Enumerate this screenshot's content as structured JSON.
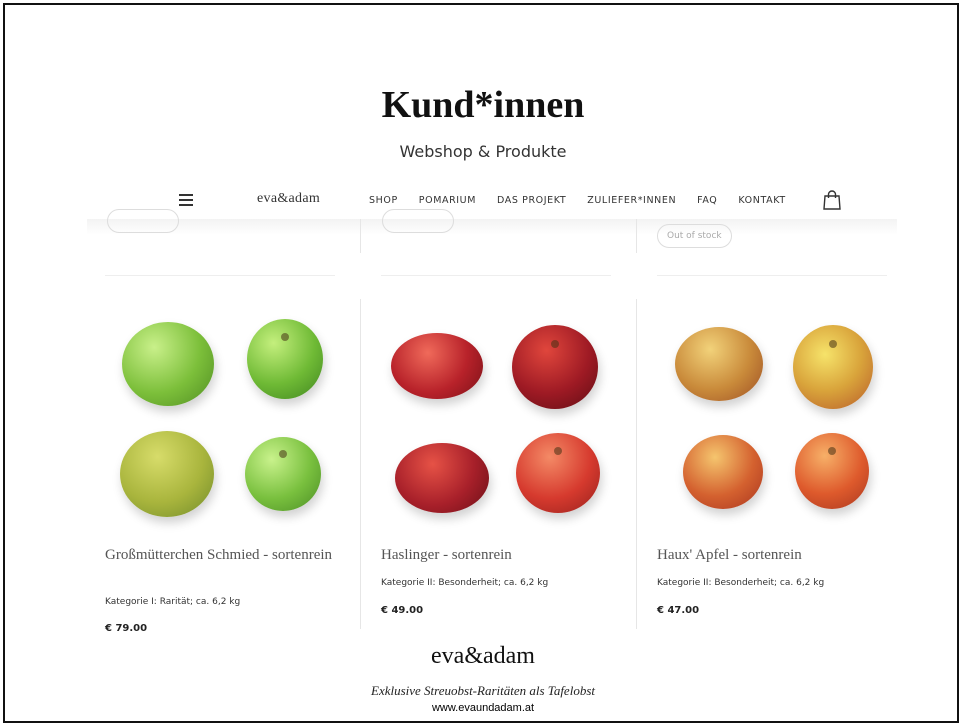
{
  "slide": {
    "title": "Kund*innen",
    "subtitle": "Webshop & Produkte"
  },
  "navbar": {
    "logo": "eva&adam",
    "links": [
      "SHOP",
      "POMARIUM",
      "DAS PROJEKT",
      "ZULIEFER*INNEN",
      "FAQ",
      "KONTAKT"
    ]
  },
  "previous_row": {
    "stock_badge": "Out of stock"
  },
  "products": [
    {
      "name": "Großmütterchen Schmied - sortenrein",
      "meta": "Kategorie I: Rarität; ca. 6,2 kg",
      "price": "€ 79.00",
      "apple_colors": [
        "#7cbf3a",
        "#6fba35",
        "#a9b53d",
        "#79c03e"
      ]
    },
    {
      "name": "Haslinger - sortenrein",
      "meta": "Kategorie II: Besonderheit; ca. 6,2 kg",
      "price": "€ 49.00",
      "apple_colors": [
        "#b8222a",
        "#9e1a24",
        "#a8202a",
        "#d63a2e"
      ]
    },
    {
      "name": "Haux' Apfel - sortenrein",
      "meta": "Kategorie II: Besonderheit; ca. 6,2 kg",
      "price": "€ 47.00",
      "apple_colors": [
        "#c98a3a",
        "#d9a43b",
        "#d4612f",
        "#de5a2c"
      ]
    }
  ],
  "footer": {
    "logo": "eva&adam",
    "tagline": "Exklusive Streuobst-Raritäten als Tafelobst",
    "url": "www.evaundadam.at"
  }
}
